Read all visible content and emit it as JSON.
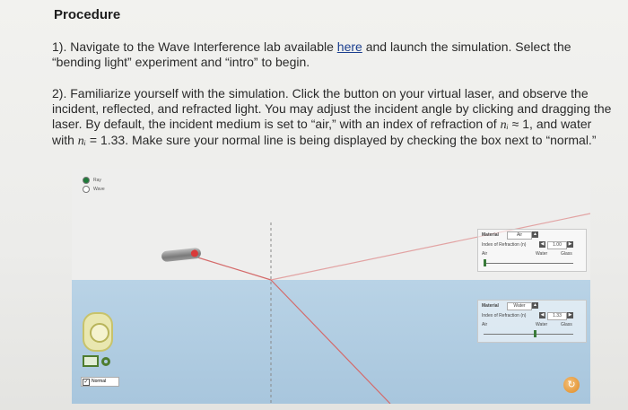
{
  "heading": "Procedure",
  "step1": {
    "before": "1). Navigate to the Wave Interference lab available ",
    "link": "here",
    "after": " and launch the simulation. Select the “bending light” experiment and “intro” to begin."
  },
  "step2": {
    "text1": "2). Familiarize yourself with the simulation. Click the button on your virtual laser, and observe the incident, reflected, and refracted light. You may adjust the incident angle by clicking and dragging the laser. By default, the incident medium is set to “air,” with an index of refraction of ",
    "var1": "nᵢ",
    "text2": " ≈ 1, and water with ",
    "var2": "nᵢ",
    "text3": " = 1.33. Make sure your normal line is being displayed by checking the box next to “normal.”"
  },
  "simulation": {
    "ray_option": "Ray",
    "wave_option": "Wave",
    "top_panel": {
      "material_label": "Material",
      "material_value": "Air",
      "index_label": "Index of Refraction (n)",
      "index_value": "1.00",
      "left_scale": "Air",
      "right_scale": "Water",
      "far_scale": "Glass"
    },
    "bottom_panel": {
      "material_label": "Material",
      "material_value": "Water",
      "index_label": "Index of Refraction (n)",
      "index_value": "1.33",
      "left_scale": "Air",
      "right_scale": "Water",
      "far_scale": "Glass"
    },
    "normal_label": "Normal",
    "colors": {
      "water": "#a8c6dd",
      "laser_beam": "#e05a5a",
      "tool_green": "#4e7c2f",
      "reset_orange": "#e08a22"
    }
  }
}
